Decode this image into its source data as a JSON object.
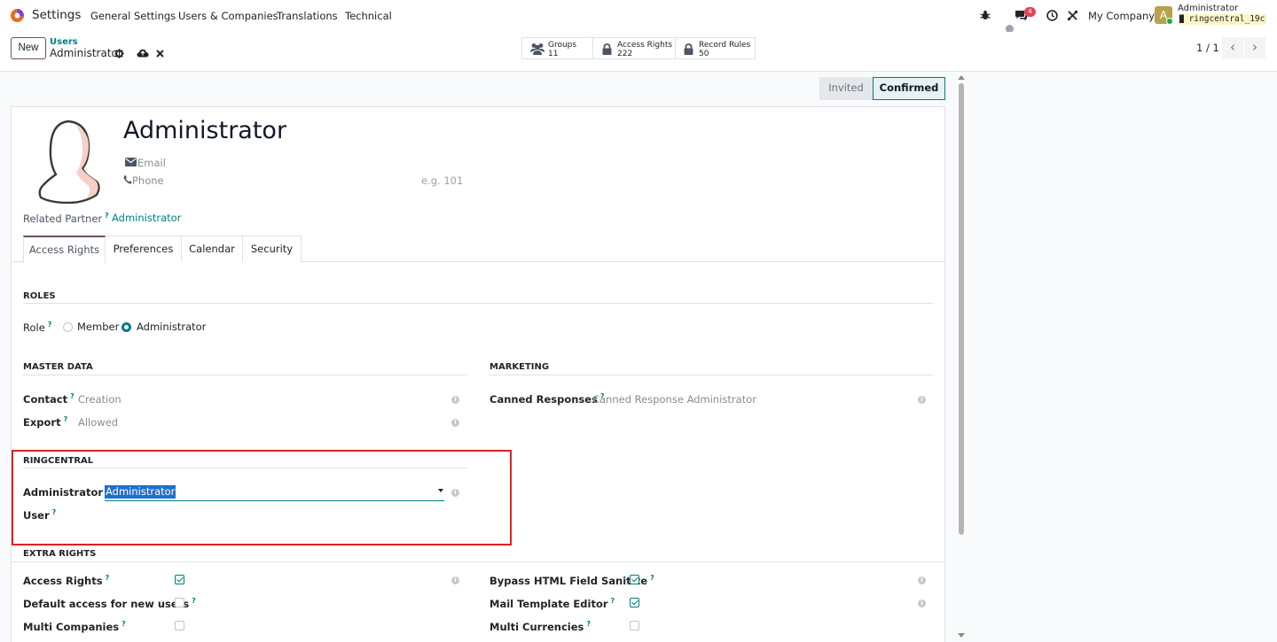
{
  "navbar": {
    "app_title": "Settings",
    "menu": [
      "General Settings",
      "Users & Companies",
      "Translations",
      "Technical"
    ],
    "company": "My Company",
    "user_name": "Administrator",
    "db_name": "ringcentral_19c",
    "avatar_letter": "A",
    "messages_badge": "4"
  },
  "control_panel": {
    "new_label": "New",
    "breadcrumb_parent": "Users",
    "breadcrumb_current": "Administrator",
    "stats": [
      {
        "label": "Groups",
        "value": "11"
      },
      {
        "label": "Access Rights",
        "value": "222"
      },
      {
        "label": "Record Rules",
        "value": "50"
      }
    ],
    "pager": "1 / 1"
  },
  "status": {
    "invited": "Invited",
    "confirmed": "Confirmed"
  },
  "form": {
    "name": "Administrator",
    "email_label": "Email",
    "phone_label": "Phone",
    "phone_placeholder": "e.g. 101",
    "related_partner_label": "Related Partner",
    "related_partner_value": "Administrator",
    "tabs": [
      "Access Rights",
      "Preferences",
      "Calendar",
      "Security"
    ],
    "roles": {
      "title": "ROLES",
      "role_label": "Role",
      "options": [
        "Member",
        "Administrator"
      ],
      "selected": "Administrator"
    },
    "master_data": {
      "title": "MASTER DATA",
      "contact_label": "Contact",
      "contact_value": "Creation",
      "export_label": "Export",
      "export_value": "Allowed"
    },
    "marketing": {
      "title": "MARKETING",
      "canned_label": "Canned Responses",
      "canned_value": "Canned Response Administrator"
    },
    "ringcentral": {
      "title": "RINGCENTRAL",
      "admin_label": "Administrator",
      "user_label": "User",
      "select_value": "Administrator"
    },
    "extra_rights": {
      "title": "EXTRA RIGHTS",
      "left": [
        {
          "label": "Access Rights",
          "checked": true
        },
        {
          "label": "Default access for new users",
          "checked": false
        },
        {
          "label": "Multi Companies",
          "checked": false
        }
      ],
      "right": [
        {
          "label": "Bypass HTML Field Sanitize",
          "checked": true
        },
        {
          "label": "Mail Template Editor",
          "checked": true
        },
        {
          "label": "Multi Currencies",
          "checked": false
        }
      ]
    }
  }
}
